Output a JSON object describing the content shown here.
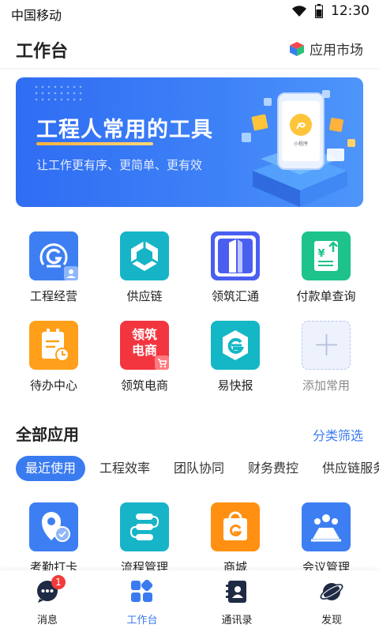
{
  "status_bar": {
    "carrier": "中国移动",
    "time": "12:30"
  },
  "header": {
    "title": "工作台",
    "market_label": "应用市场"
  },
  "banner": {
    "title": "工程人常用的工具",
    "subtitle": "让工作更有序、更简单、更有效",
    "phone_caption": "小程序"
  },
  "common_apps": [
    {
      "label": "工程经营",
      "color": "#3d7ff2"
    },
    {
      "label": "供应链",
      "color": "#17b4c8"
    },
    {
      "label": "领筑汇通",
      "color": "#4a5ff0"
    },
    {
      "label": "付款单查询",
      "color": "#1dc38a"
    },
    {
      "label": "待办中心",
      "color": "#ff9f1a"
    },
    {
      "label": "领筑电商",
      "color": "#f2353f",
      "icon_text": "领筑\n电商"
    },
    {
      "label": "易快报",
      "color": "#14b7c6"
    },
    {
      "label": "添加常用",
      "color": "#eef2fd"
    }
  ],
  "all_apps": {
    "title": "全部应用",
    "filter_label": "分类筛选",
    "tabs": [
      "最近使用",
      "工程效率",
      "团队协同",
      "财务费控",
      "供应链服务"
    ],
    "items": [
      {
        "label": "考勤打卡",
        "color": "#3d7ff2"
      },
      {
        "label": "流程管理",
        "color": "#17b4c8"
      },
      {
        "label": "商城",
        "color": "#ff9011"
      },
      {
        "label": "会议管理",
        "color": "#3d7ff2"
      }
    ]
  },
  "tab_bar": {
    "items": [
      {
        "label": "消息",
        "badge": "1"
      },
      {
        "label": "工作台"
      },
      {
        "label": "通讯录"
      },
      {
        "label": "发现"
      }
    ],
    "active_color": "#3a7bf0"
  }
}
